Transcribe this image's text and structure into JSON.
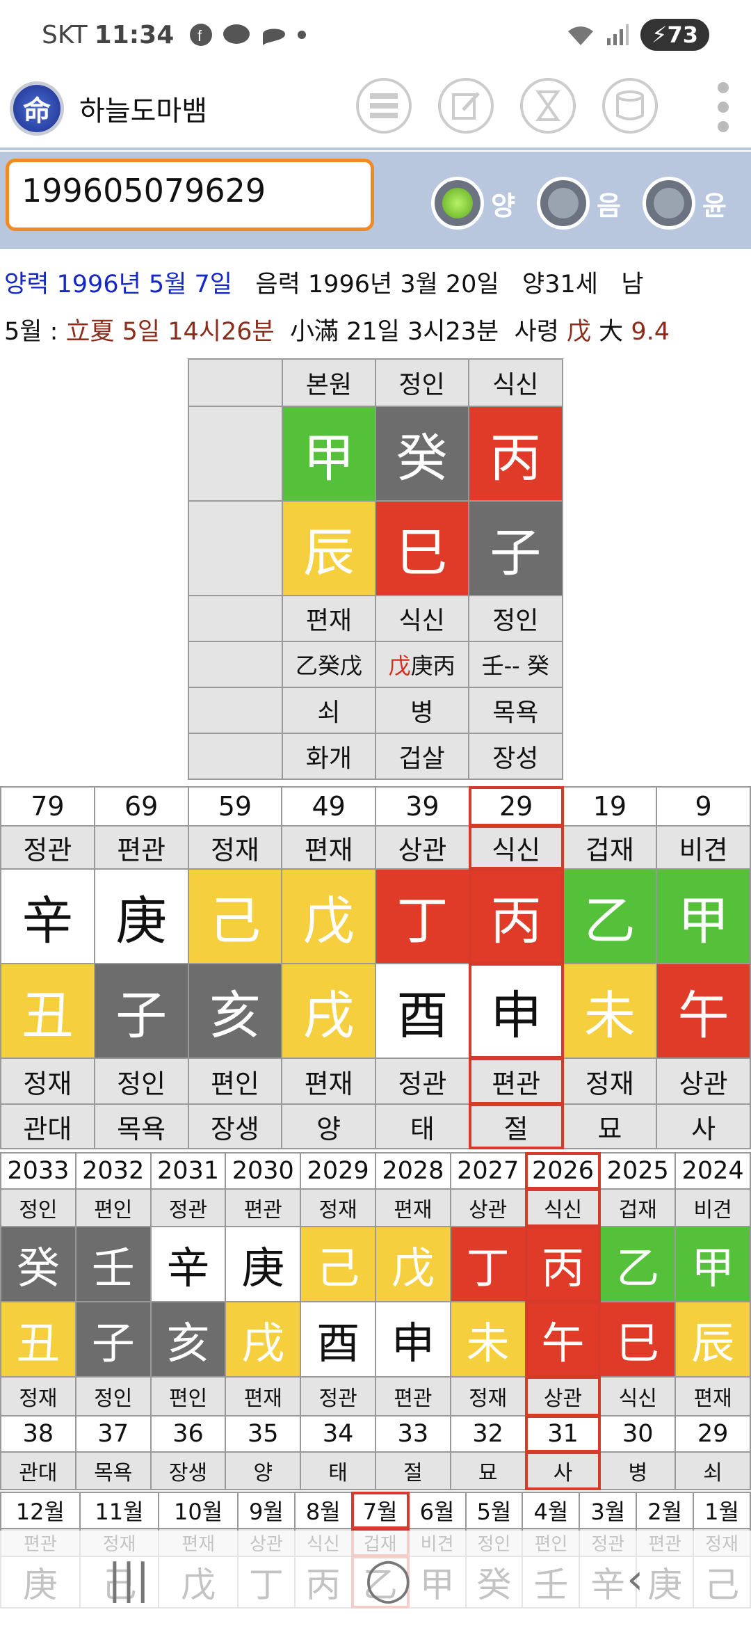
{
  "status": {
    "carrier": "SKT",
    "time": "11:34",
    "battery": "73"
  },
  "app": {
    "title": "하늘도마뱀",
    "logo": "命"
  },
  "input": {
    "value": "199605079629"
  },
  "radios": [
    {
      "label": "양",
      "on": true
    },
    {
      "label": "음",
      "on": false
    },
    {
      "label": "윤",
      "on": false
    }
  ],
  "info": {
    "solar": "양력 1996년 5월 7일",
    "lunar": "음력 1996년 3월 20일",
    "age": "양31세",
    "sex": "남",
    "month": "5월 :",
    "term1": "立夏 5일 14시26분",
    "term2": "小滿 21일 3시23분",
    "saryeong": "사령",
    "sa_char": "戊",
    "daeun": "大",
    "daeun_num": "9.4"
  },
  "natal": {
    "headers": [
      "본원",
      "정인",
      "식신"
    ],
    "stems": [
      {
        "c": "甲",
        "col": "green"
      },
      {
        "c": "癸",
        "col": "gray"
      },
      {
        "c": "丙",
        "col": "red"
      }
    ],
    "branches": [
      {
        "c": "辰",
        "col": "yellow"
      },
      {
        "c": "巳",
        "col": "red"
      },
      {
        "c": "子",
        "col": "gray"
      }
    ],
    "row1": [
      "편재",
      "식신",
      "정인"
    ],
    "hidden": [
      [
        "乙癸戊",
        ""
      ],
      [
        "",
        "戊",
        "庚丙"
      ],
      [
        "壬-- 癸",
        ""
      ]
    ],
    "row3": [
      "쇠",
      "병",
      "목욕"
    ],
    "row4": [
      "화개",
      "겁살",
      "장성"
    ]
  },
  "daeun": {
    "ages": [
      "79",
      "69",
      "59",
      "49",
      "39",
      "29",
      "19",
      "9"
    ],
    "top": [
      "정관",
      "편관",
      "정재",
      "편재",
      "상관",
      "식신",
      "겁재",
      "비견"
    ],
    "stems": [
      {
        "c": "辛",
        "col": "white"
      },
      {
        "c": "庚",
        "col": "white"
      },
      {
        "c": "己",
        "col": "yellow"
      },
      {
        "c": "戊",
        "col": "yellow"
      },
      {
        "c": "丁",
        "col": "red"
      },
      {
        "c": "丙",
        "col": "red"
      },
      {
        "c": "乙",
        "col": "green"
      },
      {
        "c": "甲",
        "col": "green"
      }
    ],
    "branches": [
      {
        "c": "丑",
        "col": "yellow"
      },
      {
        "c": "子",
        "col": "gray"
      },
      {
        "c": "亥",
        "col": "gray"
      },
      {
        "c": "戌",
        "col": "yellow"
      },
      {
        "c": "酉",
        "col": "white"
      },
      {
        "c": "申",
        "col": "white"
      },
      {
        "c": "未",
        "col": "yellow"
      },
      {
        "c": "午",
        "col": "red"
      }
    ],
    "bottom1": [
      "정재",
      "정인",
      "편인",
      "편재",
      "정관",
      "편관",
      "정재",
      "상관"
    ],
    "bottom2": [
      "관대",
      "목욕",
      "장생",
      "양",
      "태",
      "절",
      "묘",
      "사"
    ]
  },
  "yearly": {
    "years": [
      "2033",
      "2032",
      "2031",
      "2030",
      "2029",
      "2028",
      "2027",
      "2026",
      "2025",
      "2024"
    ],
    "top": [
      "정인",
      "편인",
      "정관",
      "편관",
      "정재",
      "편재",
      "상관",
      "식신",
      "겁재",
      "비견"
    ],
    "stems": [
      {
        "c": "癸",
        "col": "gray"
      },
      {
        "c": "壬",
        "col": "gray"
      },
      {
        "c": "辛",
        "col": "white"
      },
      {
        "c": "庚",
        "col": "white"
      },
      {
        "c": "己",
        "col": "yellow"
      },
      {
        "c": "戊",
        "col": "yellow"
      },
      {
        "c": "丁",
        "col": "red"
      },
      {
        "c": "丙",
        "col": "red"
      },
      {
        "c": "乙",
        "col": "green"
      },
      {
        "c": "甲",
        "col": "green"
      }
    ],
    "branches": [
      {
        "c": "丑",
        "col": "yellow"
      },
      {
        "c": "子",
        "col": "gray"
      },
      {
        "c": "亥",
        "col": "gray"
      },
      {
        "c": "戌",
        "col": "yellow"
      },
      {
        "c": "酉",
        "col": "white"
      },
      {
        "c": "申",
        "col": "white"
      },
      {
        "c": "未",
        "col": "yellow"
      },
      {
        "c": "午",
        "col": "red"
      },
      {
        "c": "巳",
        "col": "red"
      },
      {
        "c": "辰",
        "col": "yellow"
      }
    ],
    "bottom1": [
      "정재",
      "정인",
      "편인",
      "편재",
      "정관",
      "편관",
      "정재",
      "상관",
      "식신",
      "편재"
    ],
    "ages": [
      "38",
      "37",
      "36",
      "35",
      "34",
      "33",
      "32",
      "31",
      "30",
      "29"
    ],
    "bottom2": [
      "관대",
      "목욕",
      "장생",
      "양",
      "태",
      "절",
      "묘",
      "사",
      "병",
      "쇠"
    ]
  },
  "months": {
    "labels": [
      "12월",
      "11월",
      "10월",
      "9월",
      "8월",
      "7월",
      "6월",
      "5월",
      "4월",
      "3월",
      "2월",
      "1월"
    ],
    "top": [
      "편관",
      "정재",
      "편재",
      "상관",
      "식신",
      "겁재",
      "비견",
      "정인",
      "편인",
      "정관",
      "편관",
      "정재"
    ],
    "stems": [
      "庚",
      "己",
      "戊",
      "丁",
      "丙",
      "乙",
      "甲",
      "癸",
      "壬",
      "辛",
      "庚",
      "己"
    ]
  }
}
